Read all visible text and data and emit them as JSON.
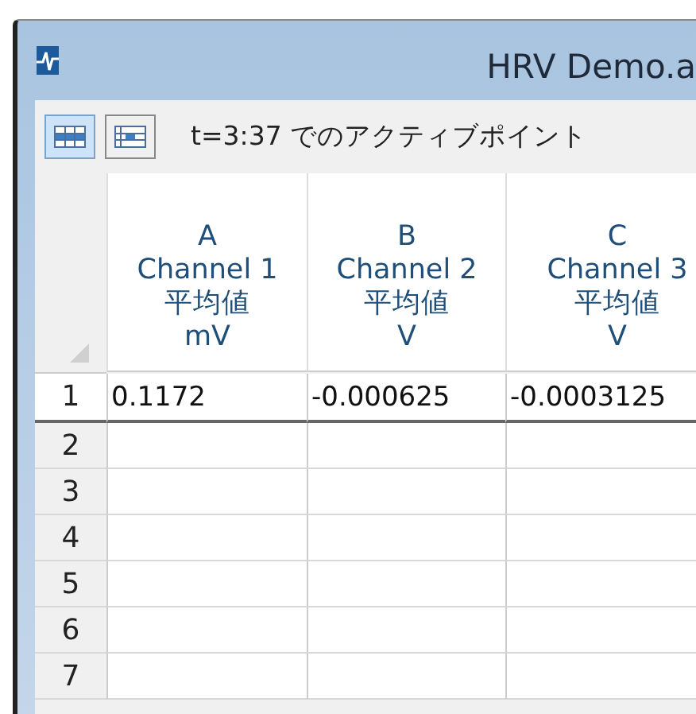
{
  "window": {
    "title": "HRV Demo.a"
  },
  "toolbar": {
    "buttons": [
      {
        "selected": true
      },
      {
        "selected": false
      }
    ],
    "label": "t=3:37 でのアクティブポイント"
  },
  "table": {
    "columns": [
      {
        "letter": "A",
        "name": "Channel 1",
        "stat": "平均値",
        "unit": "mV"
      },
      {
        "letter": "B",
        "name": "Channel 2",
        "stat": "平均値",
        "unit": "V"
      },
      {
        "letter": "C",
        "name": "Channel 3",
        "stat": "平均値",
        "unit": "V"
      }
    ],
    "rows": [
      {
        "number": "1",
        "cells": [
          "0.1172",
          "-0.000625",
          "-0.0003125"
        ]
      },
      {
        "number": "2",
        "cells": []
      },
      {
        "number": "3",
        "cells": []
      },
      {
        "number": "4",
        "cells": []
      },
      {
        "number": "5",
        "cells": []
      },
      {
        "number": "6",
        "cells": []
      },
      {
        "number": "7",
        "cells": []
      }
    ]
  }
}
